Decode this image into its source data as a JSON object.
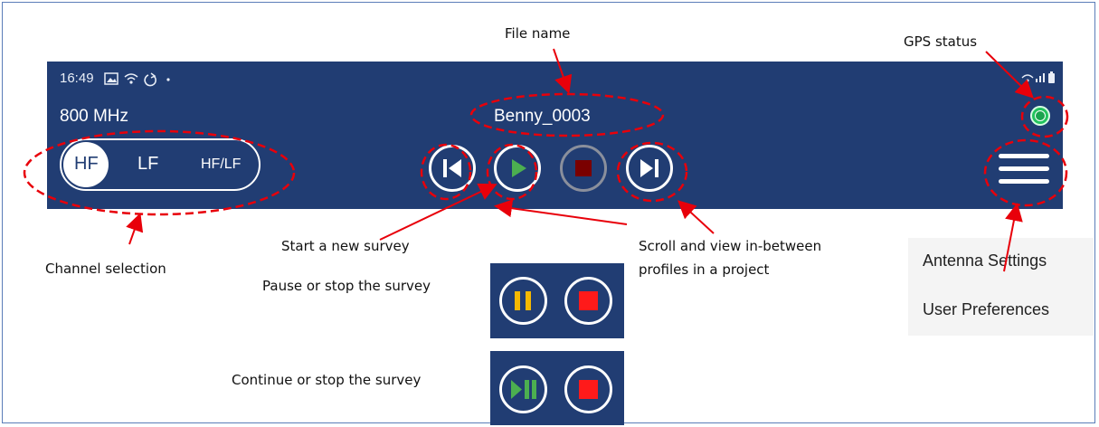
{
  "annotations": {
    "file_name": "File name",
    "gps_status": "GPS status",
    "channel_selection": "Channel selection",
    "start_survey": "Start a new survey",
    "scroll_profiles_1": "Scroll and view in-between",
    "scroll_profiles_2": "profiles in a project",
    "pause_stop": "Pause or stop the survey",
    "continue_stop": "Continue or stop the survey"
  },
  "status_bar": {
    "time": "16:49"
  },
  "app": {
    "frequency": "800 MHz",
    "file_name": "Benny_0003",
    "channels": [
      "HF",
      "LF",
      "HF/LF"
    ],
    "selected_channel": "HF",
    "gps_state": "connected"
  },
  "menu": {
    "items": [
      "Antenna Settings",
      "User Preferences"
    ]
  },
  "colors": {
    "bar_bg": "#213d73",
    "play_green": "#4caf50",
    "stop_red": "#ff1a1a",
    "stop_dark": "#7a0000",
    "pause_yellow": "#f5b800",
    "gps_green": "#22c35e",
    "callout_red": "#e8000a"
  }
}
